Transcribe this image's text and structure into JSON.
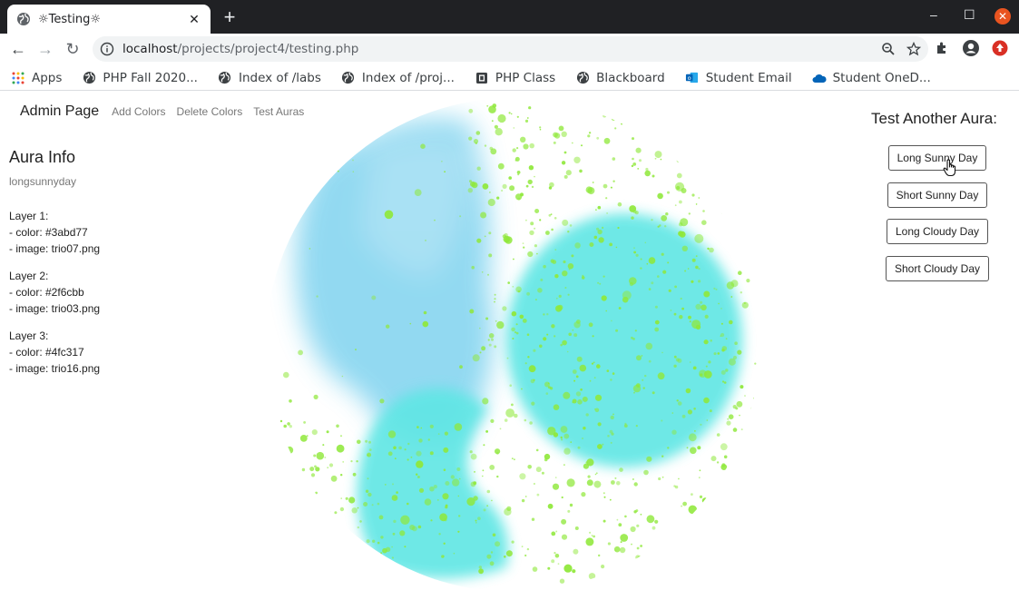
{
  "browser": {
    "tab_title": "☼Testing☼",
    "url_host": "localhost",
    "url_path": "/projects/project4/testing.php",
    "bookmarks": [
      {
        "label": "Apps",
        "icon": "apps-grid-icon"
      },
      {
        "label": "PHP Fall 2020...",
        "icon": "globe-icon"
      },
      {
        "label": "Index of /labs",
        "icon": "globe-icon"
      },
      {
        "label": "Index of /proj...",
        "icon": "globe-icon"
      },
      {
        "label": "PHP Class",
        "icon": "document-icon"
      },
      {
        "label": "Blackboard",
        "icon": "globe-icon"
      },
      {
        "label": "Student Email",
        "icon": "outlook-icon"
      },
      {
        "label": "Student OneD...",
        "icon": "cloud-icon"
      }
    ]
  },
  "nav": {
    "brand": "Admin Page",
    "links": [
      "Add Colors",
      "Delete Colors",
      "Test Auras"
    ]
  },
  "aura_info": {
    "heading": "Aura Info",
    "slug": "longsunnyday",
    "layers": [
      {
        "title": "Layer 1:",
        "color": "- color: #3abd77",
        "image": "- image: trio07.png"
      },
      {
        "title": "Layer 2:",
        "color": "- color: #2f6cbb",
        "image": "- image: trio03.png"
      },
      {
        "title": "Layer 3:",
        "color": "- color: #4fc317",
        "image": "- image: trio16.png"
      }
    ]
  },
  "test_panel": {
    "heading": "Test Another Aura:",
    "buttons": [
      "Long Sunny Day",
      "Short Sunny Day",
      "Long Cloudy Day",
      "Short Cloudy Day"
    ]
  },
  "colors": {
    "aura_blue": "#7fd3ef",
    "aura_cyan": "#5ee6e4",
    "aura_green": "#8fe83a",
    "chrome_dark": "#202124",
    "close_orange": "#e95420"
  }
}
